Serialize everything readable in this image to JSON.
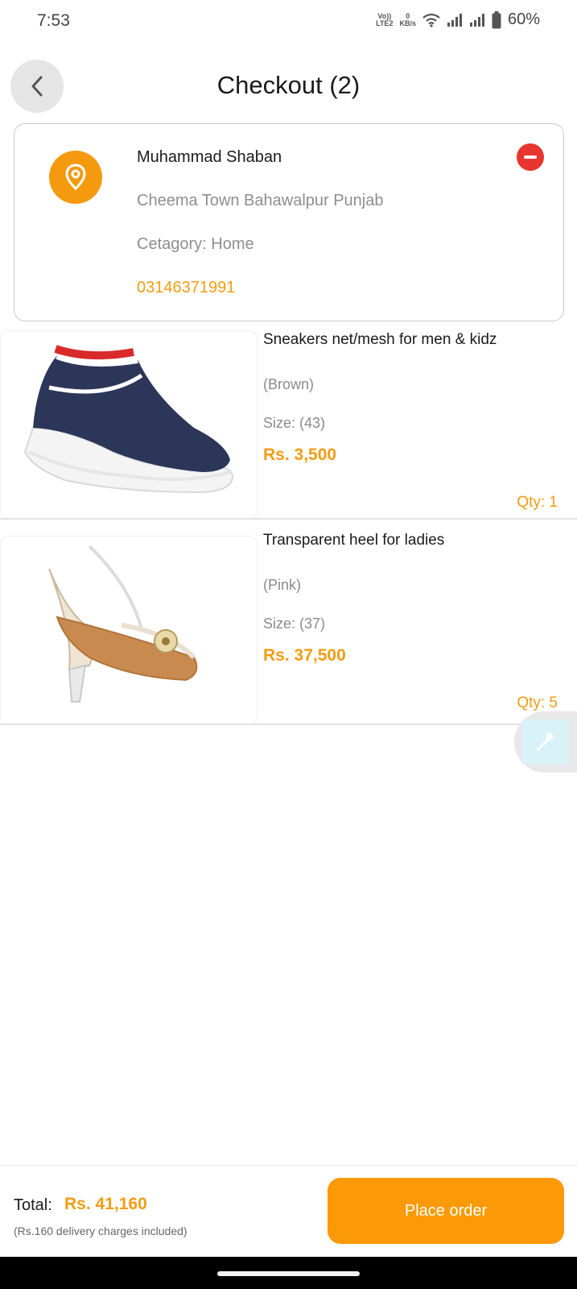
{
  "status_bar": {
    "time": "7:53",
    "volte_top": "Vo))",
    "volte_bottom": "LTE2",
    "data_rate_top": "0",
    "data_rate_bottom": "KB/s",
    "battery": "60%"
  },
  "header": {
    "title": "Checkout (2)",
    "back_icon": "chevron-left-icon"
  },
  "address": {
    "name": "Muhammad Shaban",
    "address_line": "Cheema Town Bahawalpur Punjab",
    "category": "Cetagory: Home",
    "phone": "03146371991",
    "pin_icon": "location-pin-icon",
    "remove_icon": "remove-circle-icon"
  },
  "items": [
    {
      "title": "Sneakers net/mesh for men & kidz",
      "color": "(Brown)",
      "size": "Size: (43)",
      "price": "Rs. 3,500",
      "qty": "Qty: 1",
      "image_icon": "sneaker-image"
    },
    {
      "title": "Transparent heel for ladies",
      "color": "(Pink)",
      "size": "Size: (37)",
      "price": "Rs. 37,500",
      "qty": "Qty: 5",
      "image_icon": "heel-image"
    }
  ],
  "floating_tool": {
    "icon": "eyedropper-icon"
  },
  "footer": {
    "total_label": "Total:",
    "total_value": "Rs. 41,160",
    "delivery_note": "(Rs.160 delivery charges included)",
    "place_order_label": "Place order"
  },
  "colors": {
    "accent": "#f39c12",
    "button": "#fb9a06",
    "remove": "#e8352f"
  }
}
